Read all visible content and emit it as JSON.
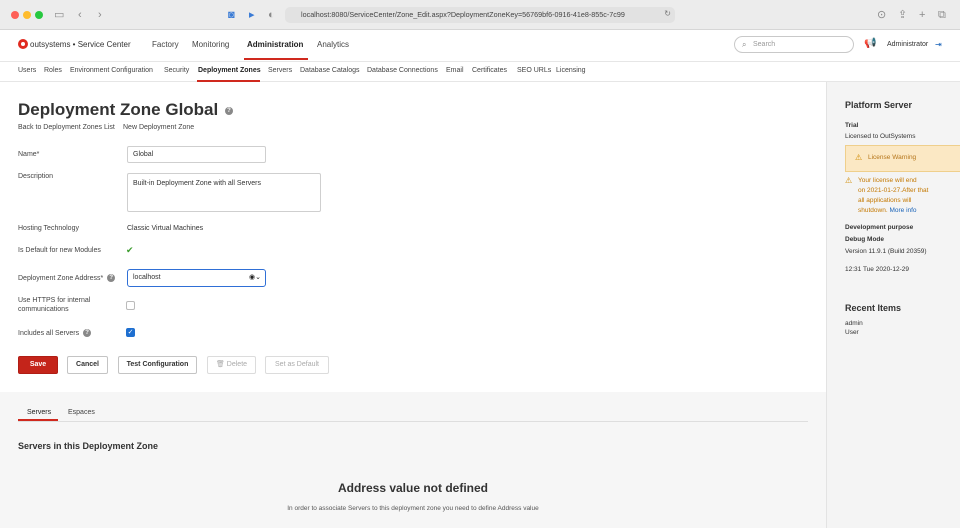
{
  "browser": {
    "url": "localhost:8080/ServiceCenter/Zone_Edit.aspx?DeploymentZoneKey=56769bf6-0916-41e8-855c-7c99"
  },
  "header": {
    "logo_text": "outsystems • Service Center",
    "nav": [
      "Factory",
      "Monitoring",
      "Administration",
      "Analytics"
    ],
    "search_placeholder": "Search",
    "user": "Administrator"
  },
  "subnav": [
    "Users",
    "Roles",
    "Environment Configuration",
    "Security",
    "Deployment Zones",
    "Servers",
    "Database Catalogs",
    "Database Connections",
    "Email",
    "Certificates",
    "SEO URLs",
    "Licensing"
  ],
  "page": {
    "title": "Deployment Zone Global",
    "link_back": "Back to Deployment Zones List",
    "link_new": "New Deployment Zone"
  },
  "form": {
    "name_label": "Name*",
    "name_value": "Global",
    "description_label": "Description",
    "description_value": "Built-in Deployment Zone with all Servers",
    "hosting_label": "Hosting Technology",
    "hosting_value": "Classic Virtual Machines",
    "default_label": "Is Default for new Modules",
    "address_label": "Deployment Zone Address*",
    "address_value": "localhost",
    "https_label_1": "Use HTTPS for internal",
    "https_label_2": "communications",
    "includes_label": "Includes all Servers"
  },
  "buttons": {
    "save": "Save",
    "cancel": "Cancel",
    "test": "Test Configuration",
    "delete": "Delete",
    "set_default": "Set as Default"
  },
  "tabs": [
    "Servers",
    "Espaces"
  ],
  "servers_section": {
    "title": "Servers in this Deployment Zone",
    "empty_title": "Address value not defined",
    "empty_text": "In order to associate Servers to this deployment zone you need to define Address value"
  },
  "sidebar": {
    "title": "Platform Server",
    "trial": "Trial",
    "licensed": "Licensed to OutSystems",
    "warning_label": "License Warning",
    "warning_line1": "Your license will end",
    "warning_line2": "on 2021-01-27.After that",
    "warning_line3": "all applications will",
    "warning_line4": "shutdown.",
    "more_info": "More info",
    "purpose": "Development purpose",
    "mode": "Debug Mode",
    "version": "Version 11.9.1 (Build 20359)",
    "time": "12:31 Tue 2020-12-29",
    "recent_title": "Recent Items",
    "recent_item": "admin",
    "recent_type": "User"
  }
}
